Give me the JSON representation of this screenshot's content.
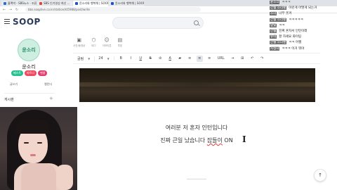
{
  "browser": {
    "tabs": [
      {
        "label": "블랙박 - SBS뉴스 · 조류 · 영남",
        "active": false,
        "fav": "news"
      },
      {
        "label": "SBS 인기영상 최신 ...",
        "active": false,
        "fav": "red"
      },
      {
        "label": "윤소리와 행복해 | SOOP",
        "active": true,
        "fav": "soop"
      },
      {
        "label": "윤소리와 행복해 | SOOP",
        "active": false,
        "fav": "soop"
      }
    ],
    "url": "bbs.sooplive.co.kr/station/kt5988/post/write"
  },
  "site": {
    "logo": "SOOP",
    "search_placeholder": ""
  },
  "channel": {
    "avatar_text": "윤소리",
    "name": "윤소리",
    "badges": [
      "베스트",
      "파트너",
      "팬클"
    ],
    "links": [
      "글쓰기",
      "캘린더"
    ],
    "board_label": "게시판",
    "board_add": "+"
  },
  "tools_top": [
    {
      "icon": "image-icon",
      "glyph": "▣",
      "label": "사진/동영상"
    },
    {
      "icon": "tag-icon",
      "glyph": "⬡",
      "label": "태그"
    },
    {
      "icon": "emoji-icon",
      "glyph": "☺",
      "label": "이모티콘"
    },
    {
      "icon": "poll-icon",
      "glyph": "▤",
      "label": "투표"
    }
  ],
  "format": {
    "font": "굴림",
    "size": "24",
    "buttons": [
      {
        "name": "bold-button",
        "glyph": "B",
        "cls": ""
      },
      {
        "name": "italic-button",
        "glyph": "I",
        "cls": ""
      },
      {
        "name": "underline-button",
        "glyph": "U",
        "cls": "u"
      },
      {
        "name": "strike-button",
        "glyph": "S",
        "cls": "s"
      },
      {
        "name": "link-icon",
        "glyph": "⊘",
        "cls": ""
      },
      {
        "name": "text-color-button",
        "glyph": "A",
        "cls": "u"
      },
      {
        "name": "bg-color-button",
        "glyph": "▰",
        "cls": ""
      },
      {
        "name": "align-left-button",
        "glyph": "≡",
        "cls": ""
      },
      {
        "name": "align-center-button",
        "glyph": "≡",
        "cls": "on"
      },
      {
        "name": "align-right-button",
        "glyph": "≡",
        "cls": ""
      },
      {
        "name": "url-button",
        "glyph": "URL",
        "cls": ""
      },
      {
        "name": "indent-icon",
        "glyph": "⇥",
        "cls": ""
      },
      {
        "name": "table-icon",
        "glyph": "⊞",
        "cls": ""
      },
      {
        "name": "undo-icon",
        "glyph": "↶",
        "cls": ""
      },
      {
        "name": "redo-icon",
        "glyph": "↷",
        "cls": ""
      }
    ]
  },
  "editor": {
    "line1": "여러분 저 혼자 인턴입니다",
    "line2_prefix": "진짜 큰일 났습니다 ",
    "line2_spell": "잡들이",
    "line2_suffix": " ON",
    "cursor_glyph": "I",
    "scroll_top_glyph": "↑"
  },
  "chat": [
    {
      "nick": "윤소리",
      "msg": "ㅋㅋㅋ"
    },
    {
      "nick": "간절 소리팬",
      "msg": "이런게 어떻게 되는거"
    },
    {
      "nick": "소리",
      "msg": "너무 웃겨"
    },
    {
      "nick": "간절 소리팬",
      "msg": "ㅋㅋㅋㅋㅋ"
    },
    {
      "nick": "달빛",
      "msg": "ㅋㅋ"
    },
    {
      "nick": "간절",
      "msg": "진짜 혼자서 인턴이래"
    },
    {
      "nick": "뉴비",
      "msg": "잘 하세요 화이팅"
    },
    {
      "nick": "간절 소리팬",
      "msg": "ㅋㅋ 어쩔"
    },
    {
      "nick": "시청자",
      "msg": "ㅋㅋㅋ 이거 뭐야"
    }
  ]
}
